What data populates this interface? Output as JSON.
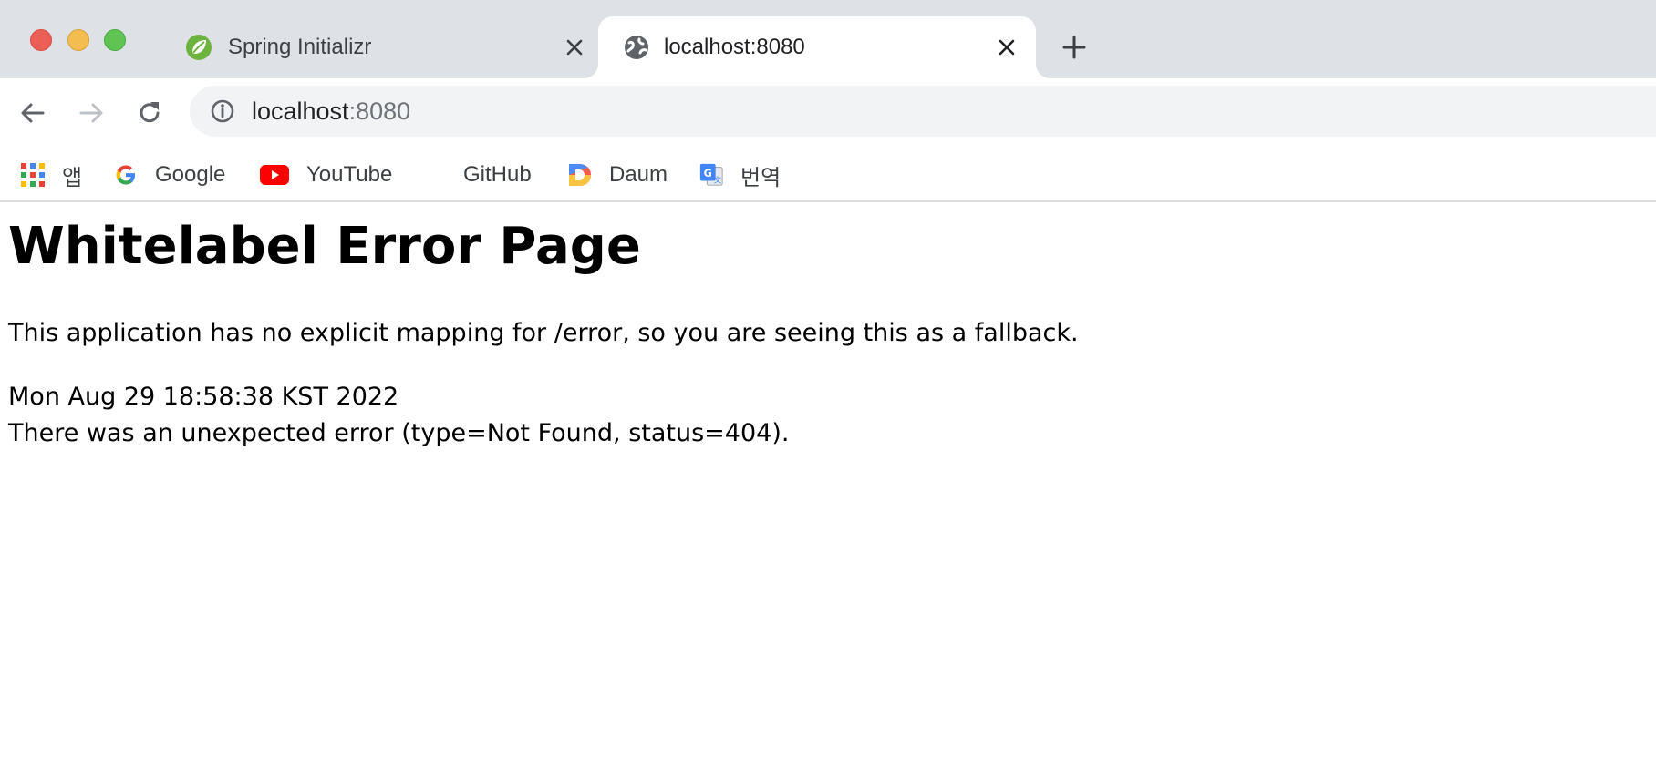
{
  "window": {
    "controls": [
      "close",
      "minimize",
      "maximize"
    ]
  },
  "tabs": [
    {
      "title": "Spring Initializr",
      "icon": "spring-leaf-icon",
      "active": false
    },
    {
      "title": "localhost:8080",
      "icon": "globe-icon",
      "active": true
    }
  ],
  "toolbar": {
    "url_host": "localhost",
    "url_port": ":8080",
    "back_icon": "arrow-left-icon",
    "forward_icon": "arrow-right-icon",
    "reload_icon": "reload-icon",
    "info_icon": "info-icon"
  },
  "bookmarks": [
    {
      "label": "앱",
      "icon": "apps-grid-icon"
    },
    {
      "label": "Google",
      "icon": "google-g-icon"
    },
    {
      "label": "YouTube",
      "icon": "youtube-icon"
    },
    {
      "label": "GitHub",
      "icon": ""
    },
    {
      "label": "Daum",
      "icon": "daum-icon"
    },
    {
      "label": "번역",
      "icon": "translate-icon"
    }
  ],
  "page": {
    "heading": "Whitelabel Error Page",
    "message": "This application has no explicit mapping for /error, so you are seeing this as a fallback.",
    "timestamp": "Mon Aug 29 18:58:38 KST 2022",
    "error": "There was an unexpected error (type=Not Found, status=404)."
  },
  "colors": {
    "tabstrip": "#dee1e6",
    "omnibox": "#f1f3f4",
    "close_light": "#ec5f56",
    "minimize_light": "#f4bd4f",
    "maximize_light": "#5fc453",
    "spring_green": "#6db33f",
    "youtube_red": "#ff0000"
  }
}
